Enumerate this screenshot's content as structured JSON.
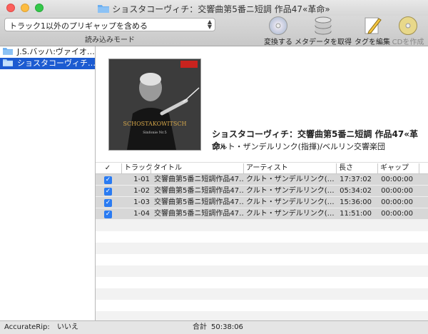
{
  "window": {
    "title": "ショスタコーヴィチ：交響曲第5番ニ短調 作品47«革命»"
  },
  "toolbar": {
    "pregap_option": "トラック1以外のプリギャップを含める",
    "mode_label": "読み込みモード",
    "tools": [
      {
        "label": "変換する",
        "icon": "cd-icon",
        "enabled": true
      },
      {
        "label": "メタデータを取得",
        "icon": "database-icon",
        "enabled": true
      },
      {
        "label": "タグを編集",
        "icon": "pencil-icon",
        "enabled": true
      },
      {
        "label": "CDを作成",
        "icon": "cd-burn-icon",
        "enabled": false
      }
    ]
  },
  "sidebar": {
    "items": [
      {
        "label": "J.S.バッハ:ヴァイオ…",
        "selected": false
      },
      {
        "label": "ショスタコーヴィチ…",
        "selected": true
      }
    ]
  },
  "album": {
    "title": "ショスタコーヴィチ：交響曲第5番ニ短調 作品47«革命»",
    "artist": "クルト・ザンデルリンク(指揮)/ベルリン交響楽団",
    "cover_text": "SCHOSTAKOWITSCH",
    "cover_subtext": "Sinfonie Nr.5"
  },
  "table": {
    "headers": {
      "check": "✓",
      "track": "トラック",
      "title": "タイトル",
      "artist": "アーティスト",
      "length": "長さ",
      "gap": "ギャップ"
    },
    "rows": [
      {
        "checked": true,
        "track": "1-01",
        "title": "交響曲第5番ニ短調作品47…",
        "artist": "クルト・ザンデルリンク(…",
        "length": "17:37:02",
        "gap": "00:00:00"
      },
      {
        "checked": true,
        "track": "1-02",
        "title": "交響曲第5番ニ短調作品47…",
        "artist": "クルト・ザンデルリンク(…",
        "length": "05:34:02",
        "gap": "00:00:00"
      },
      {
        "checked": true,
        "track": "1-03",
        "title": "交響曲第5番ニ短調作品47…",
        "artist": "クルト・ザンデルリンク(…",
        "length": "15:36:00",
        "gap": "00:00:00"
      },
      {
        "checked": true,
        "track": "1-04",
        "title": "交響曲第5番ニ短調作品47…",
        "artist": "クルト・ザンデルリンク(…",
        "length": "11:51:00",
        "gap": "00:00:00"
      }
    ]
  },
  "status": {
    "accuraterip_label": "AccurateRip:",
    "accuraterip_value": "いいえ",
    "total_label": "合計",
    "total_value": "50:38:06"
  },
  "colors": {
    "selection": "#1c5bd1",
    "checkbox": "#2a7bf2",
    "folder": "#6aaef0"
  }
}
